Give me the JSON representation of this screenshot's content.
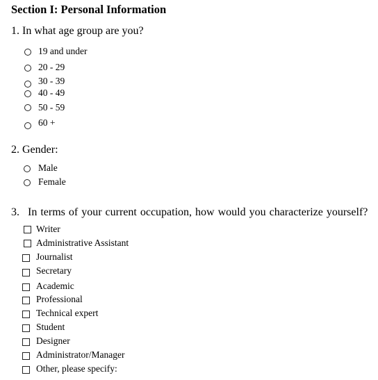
{
  "section": {
    "title": "Section I: Personal Information"
  },
  "q1": {
    "label": "1. In what age group are you?",
    "options": [
      "19 and under",
      "20 - 29",
      "30 - 39",
      "40 - 49",
      "50 - 59",
      "60 +"
    ]
  },
  "q2": {
    "label": "2. Gender:",
    "options": [
      "Male",
      "Female"
    ]
  },
  "q3": {
    "number": "3.",
    "label": "In terms of your current occupation, how would you characterize yourself?",
    "options": [
      "Writer",
      "Administrative Assistant",
      "Journalist",
      "Secretary",
      "Academic",
      "Professional",
      "Technical expert",
      "Student",
      "Designer",
      "Administrator/Manager",
      "Other, please specify:"
    ]
  }
}
